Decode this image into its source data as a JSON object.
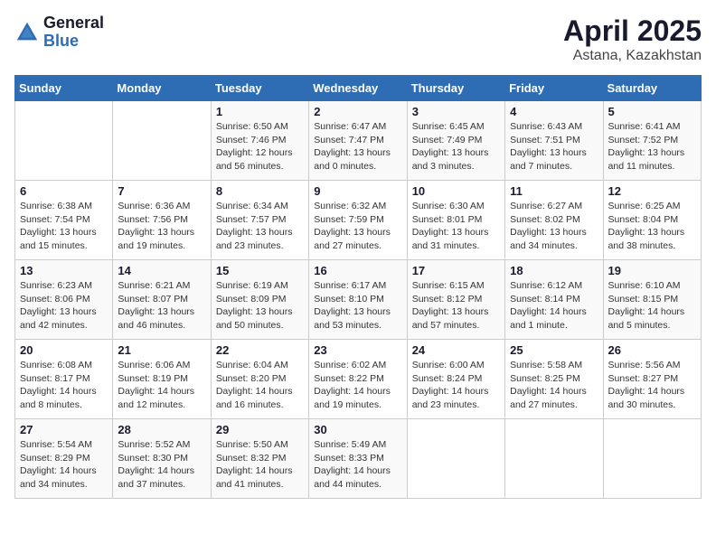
{
  "header": {
    "logo_general": "General",
    "logo_blue": "Blue",
    "title": "April 2025",
    "subtitle": "Astana, Kazakhstan"
  },
  "weekdays": [
    "Sunday",
    "Monday",
    "Tuesday",
    "Wednesday",
    "Thursday",
    "Friday",
    "Saturday"
  ],
  "weeks": [
    [
      {
        "day": "",
        "detail": ""
      },
      {
        "day": "",
        "detail": ""
      },
      {
        "day": "1",
        "detail": "Sunrise: 6:50 AM\nSunset: 7:46 PM\nDaylight: 12 hours and 56 minutes."
      },
      {
        "day": "2",
        "detail": "Sunrise: 6:47 AM\nSunset: 7:47 PM\nDaylight: 13 hours and 0 minutes."
      },
      {
        "day": "3",
        "detail": "Sunrise: 6:45 AM\nSunset: 7:49 PM\nDaylight: 13 hours and 3 minutes."
      },
      {
        "day": "4",
        "detail": "Sunrise: 6:43 AM\nSunset: 7:51 PM\nDaylight: 13 hours and 7 minutes."
      },
      {
        "day": "5",
        "detail": "Sunrise: 6:41 AM\nSunset: 7:52 PM\nDaylight: 13 hours and 11 minutes."
      }
    ],
    [
      {
        "day": "6",
        "detail": "Sunrise: 6:38 AM\nSunset: 7:54 PM\nDaylight: 13 hours and 15 minutes."
      },
      {
        "day": "7",
        "detail": "Sunrise: 6:36 AM\nSunset: 7:56 PM\nDaylight: 13 hours and 19 minutes."
      },
      {
        "day": "8",
        "detail": "Sunrise: 6:34 AM\nSunset: 7:57 PM\nDaylight: 13 hours and 23 minutes."
      },
      {
        "day": "9",
        "detail": "Sunrise: 6:32 AM\nSunset: 7:59 PM\nDaylight: 13 hours and 27 minutes."
      },
      {
        "day": "10",
        "detail": "Sunrise: 6:30 AM\nSunset: 8:01 PM\nDaylight: 13 hours and 31 minutes."
      },
      {
        "day": "11",
        "detail": "Sunrise: 6:27 AM\nSunset: 8:02 PM\nDaylight: 13 hours and 34 minutes."
      },
      {
        "day": "12",
        "detail": "Sunrise: 6:25 AM\nSunset: 8:04 PM\nDaylight: 13 hours and 38 minutes."
      }
    ],
    [
      {
        "day": "13",
        "detail": "Sunrise: 6:23 AM\nSunset: 8:06 PM\nDaylight: 13 hours and 42 minutes."
      },
      {
        "day": "14",
        "detail": "Sunrise: 6:21 AM\nSunset: 8:07 PM\nDaylight: 13 hours and 46 minutes."
      },
      {
        "day": "15",
        "detail": "Sunrise: 6:19 AM\nSunset: 8:09 PM\nDaylight: 13 hours and 50 minutes."
      },
      {
        "day": "16",
        "detail": "Sunrise: 6:17 AM\nSunset: 8:10 PM\nDaylight: 13 hours and 53 minutes."
      },
      {
        "day": "17",
        "detail": "Sunrise: 6:15 AM\nSunset: 8:12 PM\nDaylight: 13 hours and 57 minutes."
      },
      {
        "day": "18",
        "detail": "Sunrise: 6:12 AM\nSunset: 8:14 PM\nDaylight: 14 hours and 1 minute."
      },
      {
        "day": "19",
        "detail": "Sunrise: 6:10 AM\nSunset: 8:15 PM\nDaylight: 14 hours and 5 minutes."
      }
    ],
    [
      {
        "day": "20",
        "detail": "Sunrise: 6:08 AM\nSunset: 8:17 PM\nDaylight: 14 hours and 8 minutes."
      },
      {
        "day": "21",
        "detail": "Sunrise: 6:06 AM\nSunset: 8:19 PM\nDaylight: 14 hours and 12 minutes."
      },
      {
        "day": "22",
        "detail": "Sunrise: 6:04 AM\nSunset: 8:20 PM\nDaylight: 14 hours and 16 minutes."
      },
      {
        "day": "23",
        "detail": "Sunrise: 6:02 AM\nSunset: 8:22 PM\nDaylight: 14 hours and 19 minutes."
      },
      {
        "day": "24",
        "detail": "Sunrise: 6:00 AM\nSunset: 8:24 PM\nDaylight: 14 hours and 23 minutes."
      },
      {
        "day": "25",
        "detail": "Sunrise: 5:58 AM\nSunset: 8:25 PM\nDaylight: 14 hours and 27 minutes."
      },
      {
        "day": "26",
        "detail": "Sunrise: 5:56 AM\nSunset: 8:27 PM\nDaylight: 14 hours and 30 minutes."
      }
    ],
    [
      {
        "day": "27",
        "detail": "Sunrise: 5:54 AM\nSunset: 8:29 PM\nDaylight: 14 hours and 34 minutes."
      },
      {
        "day": "28",
        "detail": "Sunrise: 5:52 AM\nSunset: 8:30 PM\nDaylight: 14 hours and 37 minutes."
      },
      {
        "day": "29",
        "detail": "Sunrise: 5:50 AM\nSunset: 8:32 PM\nDaylight: 14 hours and 41 minutes."
      },
      {
        "day": "30",
        "detail": "Sunrise: 5:49 AM\nSunset: 8:33 PM\nDaylight: 14 hours and 44 minutes."
      },
      {
        "day": "",
        "detail": ""
      },
      {
        "day": "",
        "detail": ""
      },
      {
        "day": "",
        "detail": ""
      }
    ]
  ]
}
